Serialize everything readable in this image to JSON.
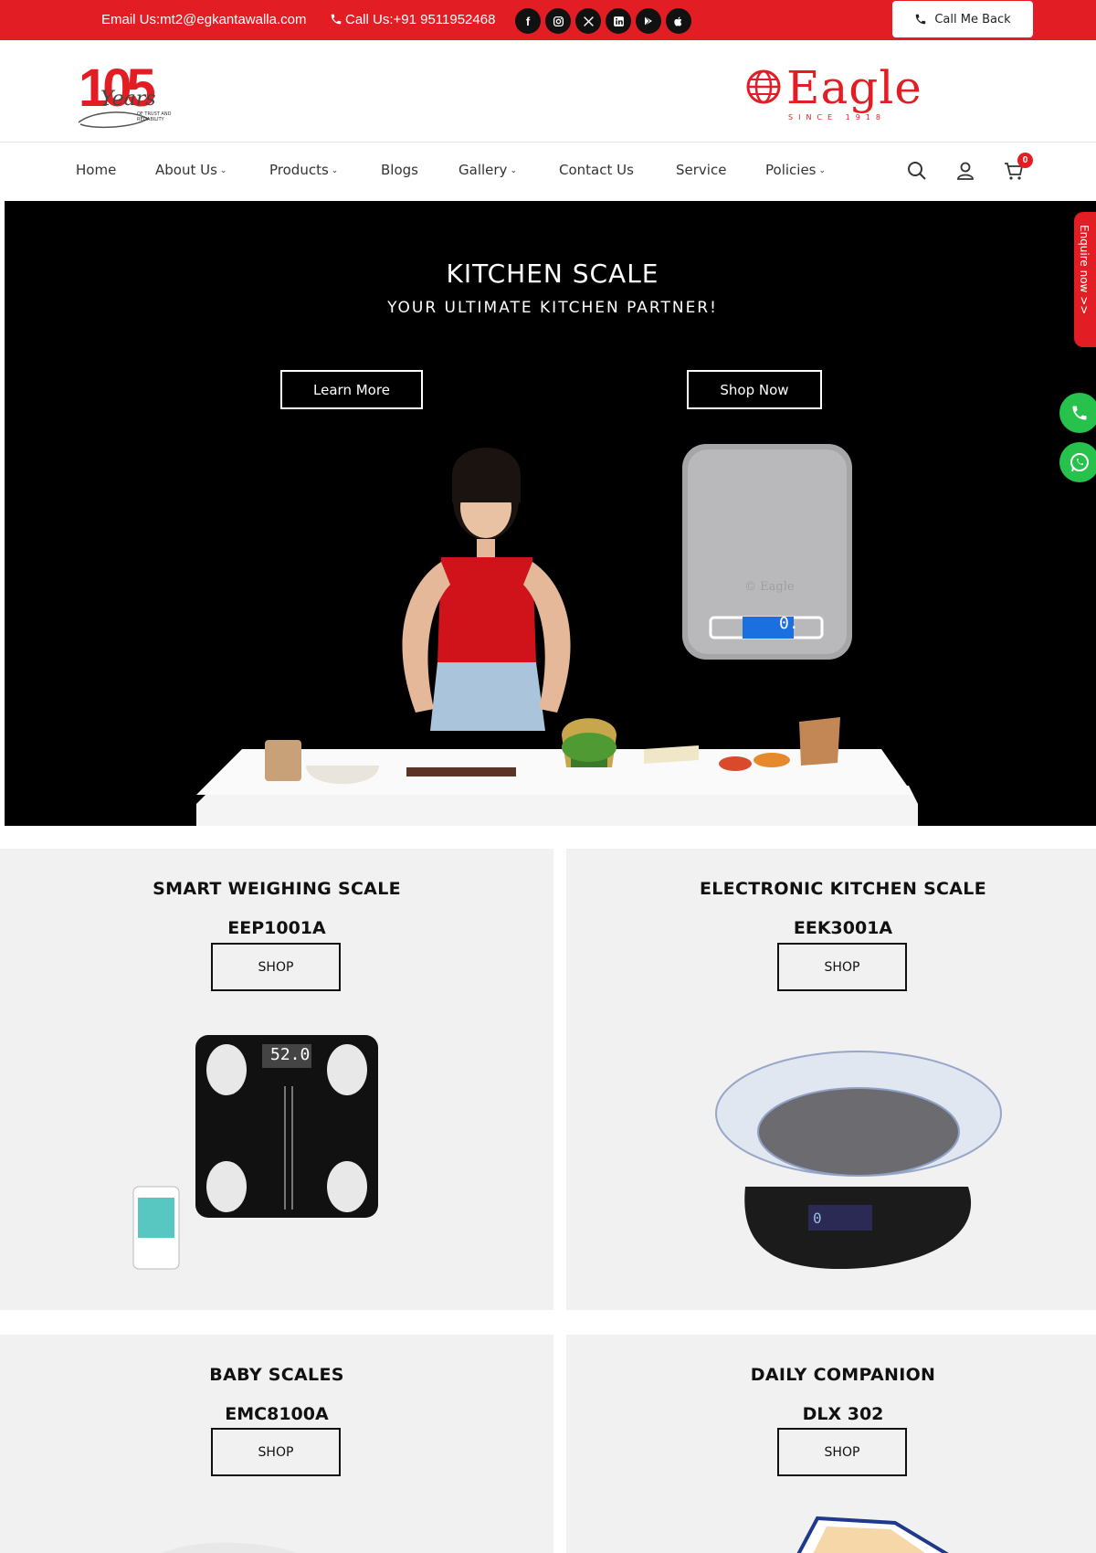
{
  "topbar": {
    "email": "Email Us:mt2@egkantawalla.com",
    "phone": "Call Us:+91 9511952468",
    "socials": [
      "facebook-icon",
      "instagram-icon",
      "x-icon",
      "linkedin-icon",
      "google-play-icon",
      "apple-icon"
    ],
    "callback_label": "Call Me Back"
  },
  "header": {
    "anniversary_number": "105",
    "anniversary_word": "Years",
    "anniversary_tag": "OF TRUST AND RELIABILITY",
    "brand_name": "Eagle",
    "brand_since": "SINCE 1918"
  },
  "nav": {
    "items": [
      {
        "label": "Home",
        "has_dropdown": false
      },
      {
        "label": "About Us",
        "has_dropdown": true
      },
      {
        "label": "Products",
        "has_dropdown": true
      },
      {
        "label": "Blogs",
        "has_dropdown": false
      },
      {
        "label": "Gallery",
        "has_dropdown": true
      },
      {
        "label": "Contact Us",
        "has_dropdown": false
      },
      {
        "label": "Service",
        "has_dropdown": false
      },
      {
        "label": "Policies",
        "has_dropdown": true
      }
    ],
    "cart_count": "0"
  },
  "hero": {
    "title": "KITCHEN SCALE",
    "subtitle": "YOUR  ULTIMATE  KITCHEN  PARTNER!",
    "learn_more": "Learn More",
    "shop_now": "Shop Now",
    "scale_display": "0.",
    "scale_brand": "Eagle"
  },
  "side": {
    "enquire": "Enquire now >>"
  },
  "products": [
    {
      "title": "SMART WEIGHING SCALE",
      "model": "EEP1001A",
      "button": "SHOP",
      "display": "52.0"
    },
    {
      "title": "ELECTRONIC KITCHEN SCALE",
      "model": "EEK3001A",
      "button": "SHOP",
      "display": "0"
    },
    {
      "title": "BABY SCALES",
      "model": "EMC8100A",
      "button": "SHOP"
    },
    {
      "title": "DAILY COMPANION",
      "model": "DLX 302",
      "button": "SHOP"
    }
  ],
  "colors": {
    "brand_red": "#e21e24",
    "whatsapp_green": "#27c24c",
    "tile_bg": "#f1f1f1"
  }
}
